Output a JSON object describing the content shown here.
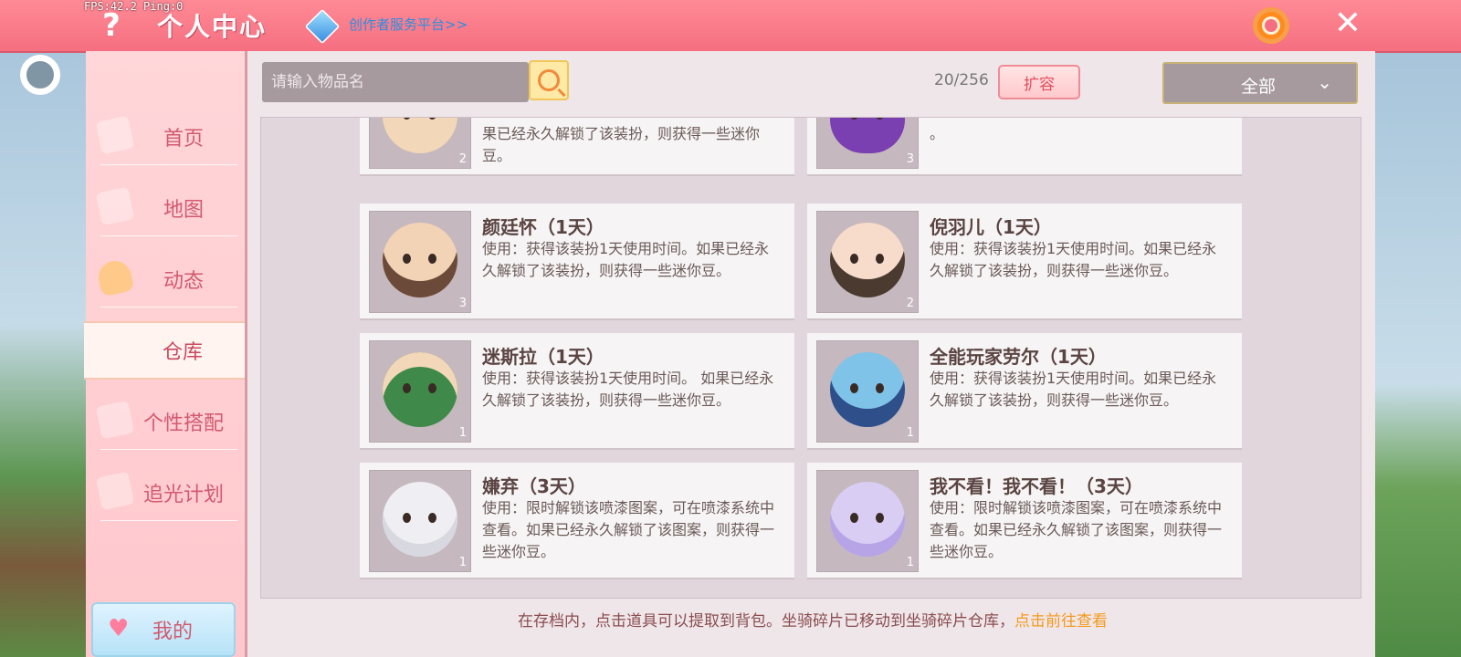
{
  "status": {
    "fps": "FPS:42.2  Ping:0"
  },
  "header": {
    "title": "个人中心",
    "creator_link": "创作者服务平台>>",
    "help_glyph": "?",
    "close_glyph": "✕"
  },
  "sidebar": {
    "items": [
      {
        "label": "首页",
        "active": false
      },
      {
        "label": "地图",
        "active": false
      },
      {
        "label": "动态",
        "active": false
      },
      {
        "label": "仓库",
        "active": true
      },
      {
        "label": "个性搭配",
        "active": false
      },
      {
        "label": "追光计划",
        "active": false
      }
    ],
    "my_button": "我的"
  },
  "toolbar": {
    "search_placeholder": "请输入物品名",
    "capacity": "20/256",
    "expand_label": "扩容",
    "filter_value": "全部",
    "filter_chevron": "⌄"
  },
  "items": [
    {
      "title": "",
      "desc": "果已经永久解锁了该装扮，则获得一些迷你豆。",
      "qty": "2",
      "avatar_color": "#f2d7b8"
    },
    {
      "title": "",
      "desc": "。",
      "qty": "3",
      "avatar_color": "#7a3fb0"
    },
    {
      "title": "颜廷怀（1天）",
      "desc": "使用：获得该装扮1天使用时间。如果已经永久解锁了该装扮，则获得一些迷你豆。",
      "qty": "3",
      "avatar_color": "#f3d3b5"
    },
    {
      "title": "倪羽儿（1天）",
      "desc": "使用：获得该装扮1天使用时间。如果已经永久解锁了该装扮，则获得一些迷你豆。",
      "qty": "2",
      "avatar_color": "#f7dccb"
    },
    {
      "title": "迷斯拉（1天）",
      "desc": "使用：获得该装扮1天使用时间。 如果已经永久解锁了该装扮，则获得一些迷你豆。",
      "qty": "1",
      "avatar_color": "#3f8a4a"
    },
    {
      "title": "全能玩家劳尔（1天）",
      "desc": "使用：获得该装扮1天使用时间。如果已经永久解锁了该装扮，则获得一些迷你豆。",
      "qty": "1",
      "avatar_color": "#7fc3e8"
    },
    {
      "title": "嫌弃（3天）",
      "desc": "使用：限时解锁该喷漆图案，可在喷漆系统中查看。如果已经永久解锁了该图案，则获得一些迷你豆。",
      "qty": "1",
      "avatar_color": "#efeff3"
    },
    {
      "title": "我不看！我不看！（3天）",
      "desc": "使用：限时解锁该喷漆图案，可在喷漆系统中查看。如果已经永久解锁了该图案，则获得一些迷你豆。",
      "qty": "1",
      "avatar_color": "#d9cdf3"
    }
  ],
  "footer": {
    "tip": "在存档内，点击道具可以提取到背包。坐骑碎片已移动到坐骑碎片仓库，",
    "link": "点击前往查看"
  }
}
